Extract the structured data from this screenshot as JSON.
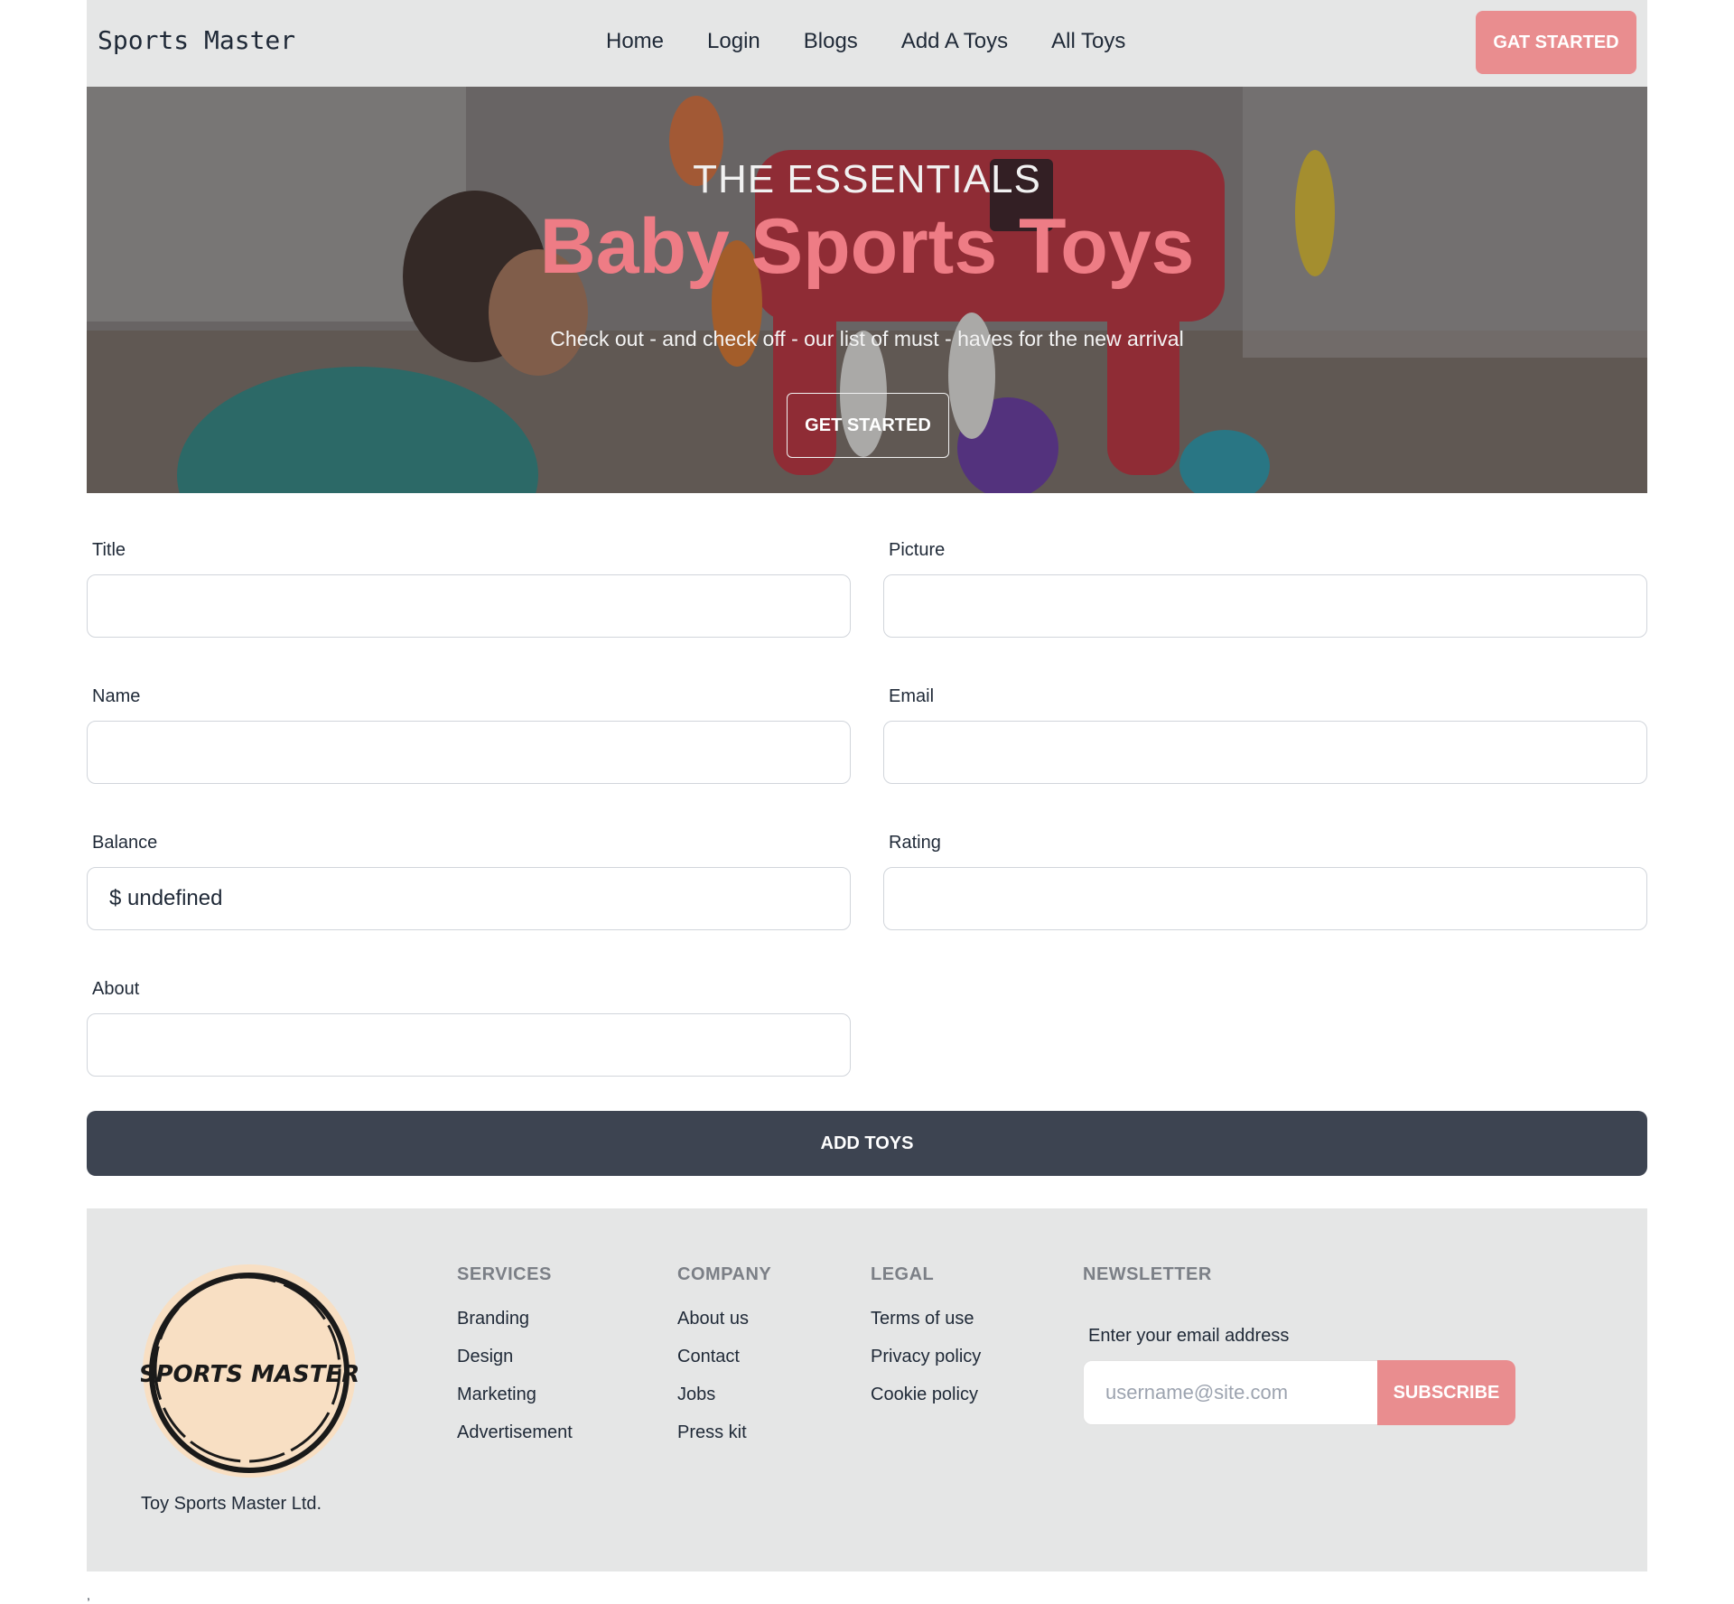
{
  "navbar": {
    "brand": "Sports Master",
    "links": [
      "Home",
      "Login",
      "Blogs",
      "Add A Toys",
      "All Toys"
    ],
    "cta": "GAT STARTED"
  },
  "hero": {
    "subtitle": "THE ESSENTIALS",
    "title": "Baby Sports Toys",
    "description": "Check out - and check off - our list of must - haves for the new arrival",
    "button": "GET STARTED"
  },
  "form": {
    "title_label": "Title",
    "picture_label": "Picture",
    "name_label": "Name",
    "email_label": "Email",
    "balance_label": "Balance",
    "balance_value": "$ undefined",
    "rating_label": "Rating",
    "about_label": "About",
    "submit": "ADD TOYS"
  },
  "footer": {
    "logo_text": "SPORTS MASTER",
    "company": "Toy Sports Master Ltd.",
    "services": {
      "heading": "SERVICES",
      "links": [
        "Branding",
        "Design",
        "Marketing",
        "Advertisement"
      ]
    },
    "company_col": {
      "heading": "COMPANY",
      "links": [
        "About us",
        "Contact",
        "Jobs",
        "Press kit"
      ]
    },
    "legal": {
      "heading": "LEGAL",
      "links": [
        "Terms of use",
        "Privacy policy",
        "Cookie policy"
      ]
    },
    "newsletter": {
      "heading": "NEWSLETTER",
      "label": "Enter your email address",
      "placeholder": "username@site.com",
      "button": "SUBSCRIBE"
    }
  },
  "colors": {
    "accent": "#e98d8f",
    "hero_title": "#ee7c85",
    "dark": "#3d4451",
    "gray_bg": "#e5e6e6"
  },
  "trailing_mark": ","
}
